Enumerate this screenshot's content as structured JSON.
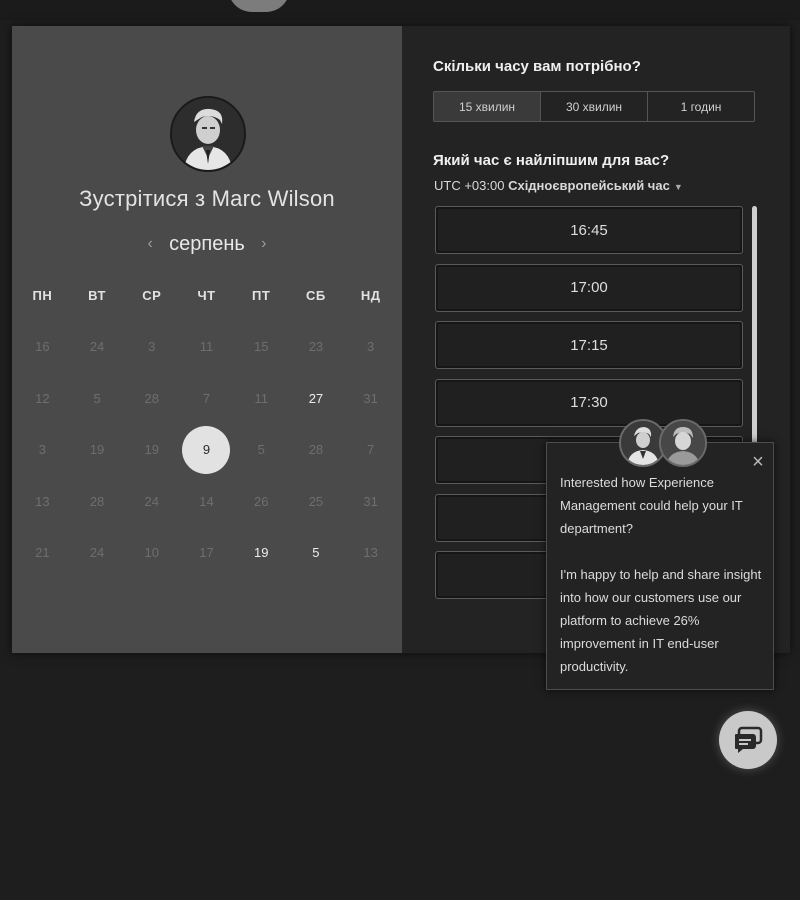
{
  "host": {
    "meet_prefix": "Зустрітися з",
    "name": "Marc Wilson"
  },
  "calendar": {
    "month": "серпень",
    "weekdays": [
      "ПН",
      "ВТ",
      "СР",
      "ЧТ",
      "ПТ",
      "СБ",
      "НД"
    ],
    "weeks": [
      [
        "16",
        "24",
        "3",
        "11",
        "15",
        "23",
        "3"
      ],
      [
        "12",
        "5",
        "28",
        "7",
        "11",
        "27",
        "31"
      ],
      [
        "3",
        "19",
        "19",
        "9",
        "5",
        "28",
        "7"
      ],
      [
        "13",
        "28",
        "24",
        "14",
        "26",
        "25",
        "31"
      ],
      [
        "21",
        "24",
        "10",
        "17",
        "19",
        "5",
        "13"
      ]
    ],
    "available": [
      "1-5",
      "4-4",
      "4-5"
    ],
    "selected": "2-3"
  },
  "duration": {
    "question": "Скільки часу вам потрібно?",
    "options": [
      "15 хвилин",
      "30 хвилин",
      "1 годин"
    ],
    "selected_index": 0
  },
  "time": {
    "question": "Який час є найліпшим для вас?",
    "tz_offset": "UTC +03:00",
    "tz_name": "Східноєвропейський час",
    "slots": [
      "16:45",
      "17:00",
      "17:15",
      "17:30",
      "",
      "",
      ""
    ]
  },
  "popup": {
    "paragraph1": "Interested how Experience Management could help your IT department?",
    "paragraph2": "I'm happy to help and share insight into how our customers use our platform to achieve 26% improvement in IT end-user productivity.",
    "close_glyph": "×"
  },
  "icons": {
    "prev": "‹",
    "next": "›",
    "caret": "▼"
  }
}
